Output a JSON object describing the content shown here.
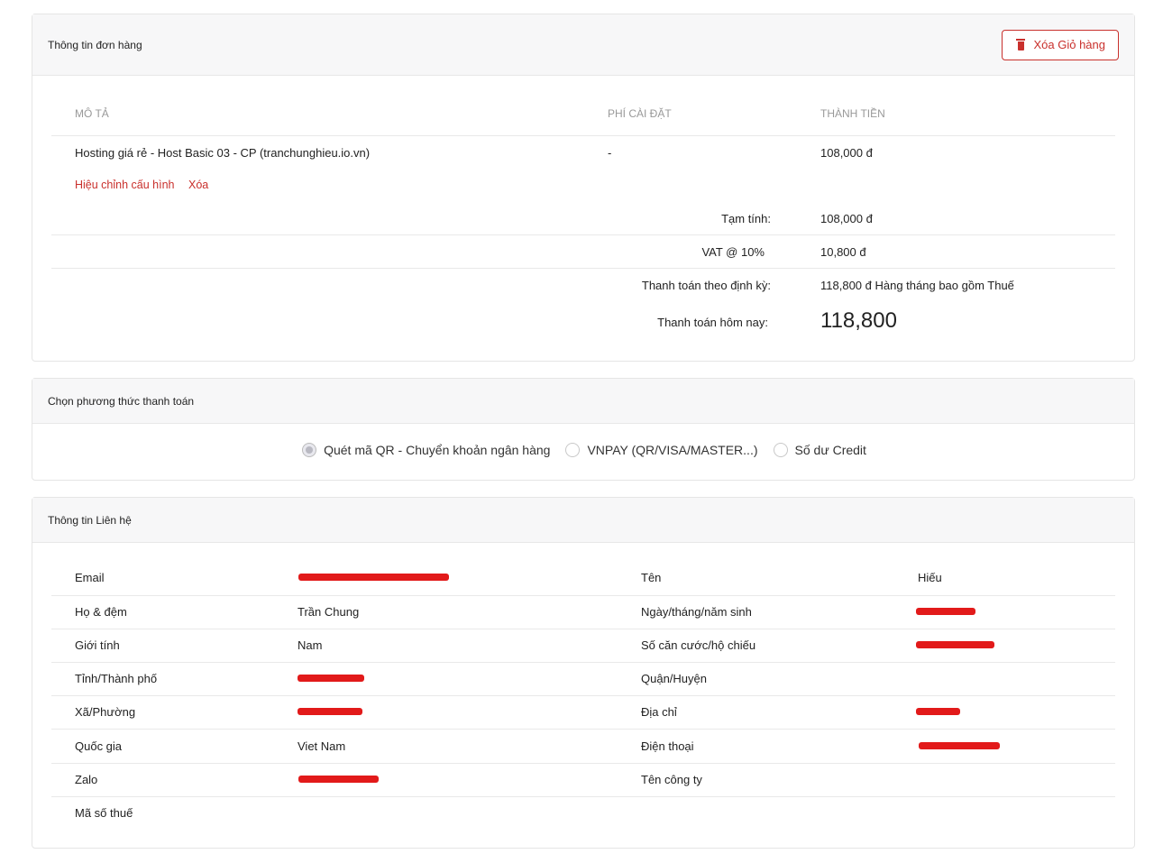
{
  "order": {
    "title": "Thông tin đơn hàng",
    "clear_cart_label": "Xóa Giỏ hàng",
    "columns": {
      "description": "MÔ TẢ",
      "setup_fee": "PHÍ CÀI ĐẶT",
      "total": "THÀNH TIỀN"
    },
    "item": {
      "description": "Hosting giá rẻ - Host Basic 03 - CP (tranchunghieu.io.vn)",
      "setup_fee": "-",
      "total": "108,000 đ",
      "edit_label": "Hiệu chỉnh cấu hình",
      "delete_label": "Xóa"
    },
    "subtotal": {
      "label": "Tạm tính:",
      "value": "108,000 đ"
    },
    "vat": {
      "label": "VAT @ 10%",
      "value": "10,800 đ"
    },
    "recurring": {
      "label": "Thanh toán theo định kỳ:",
      "value": "118,800 đ Hàng tháng bao gồm Thuế"
    },
    "today": {
      "label": "Thanh toán hôm nay:",
      "value": "118,800"
    }
  },
  "payment": {
    "title": "Chọn phương thức thanh toán",
    "options": [
      {
        "label": "Quét mã QR - Chuyển khoản ngân hàng",
        "selected": true
      },
      {
        "label": "VNPAY (QR/VISA/MASTER...)",
        "selected": false
      },
      {
        "label": "Số dư Credit",
        "selected": false
      }
    ]
  },
  "contact": {
    "title": "Thông tin Liên hệ",
    "rows": [
      {
        "l1": "Email",
        "v1": "",
        "l2": "Tên",
        "v2": "Hiếu"
      },
      {
        "l1": "Họ & đệm",
        "v1": "Trần Chung",
        "l2": "Ngày/tháng/năm sinh",
        "v2": ""
      },
      {
        "l1": "Giới tính",
        "v1": "Nam",
        "l2": "Số căn cước/hộ chiếu",
        "v2": ""
      },
      {
        "l1": "Tỉnh/Thành phố",
        "v1": "",
        "l2": "Quận/Huyện",
        "v2": ""
      },
      {
        "l1": "Xã/Phường",
        "v1": "",
        "l2": "Địa chỉ",
        "v2": ""
      },
      {
        "l1": "Quốc gia",
        "v1": "Viet Nam",
        "l2": "Điện thoại",
        "v2": ""
      },
      {
        "l1": "Zalo",
        "v1": "",
        "l2": "Tên công ty",
        "v2": ""
      },
      {
        "l1": "Mã số thuế",
        "v1": "",
        "l2": "",
        "v2": ""
      }
    ]
  },
  "colors": {
    "accent_red": "#c9302c",
    "redaction": "#e21a1a"
  }
}
